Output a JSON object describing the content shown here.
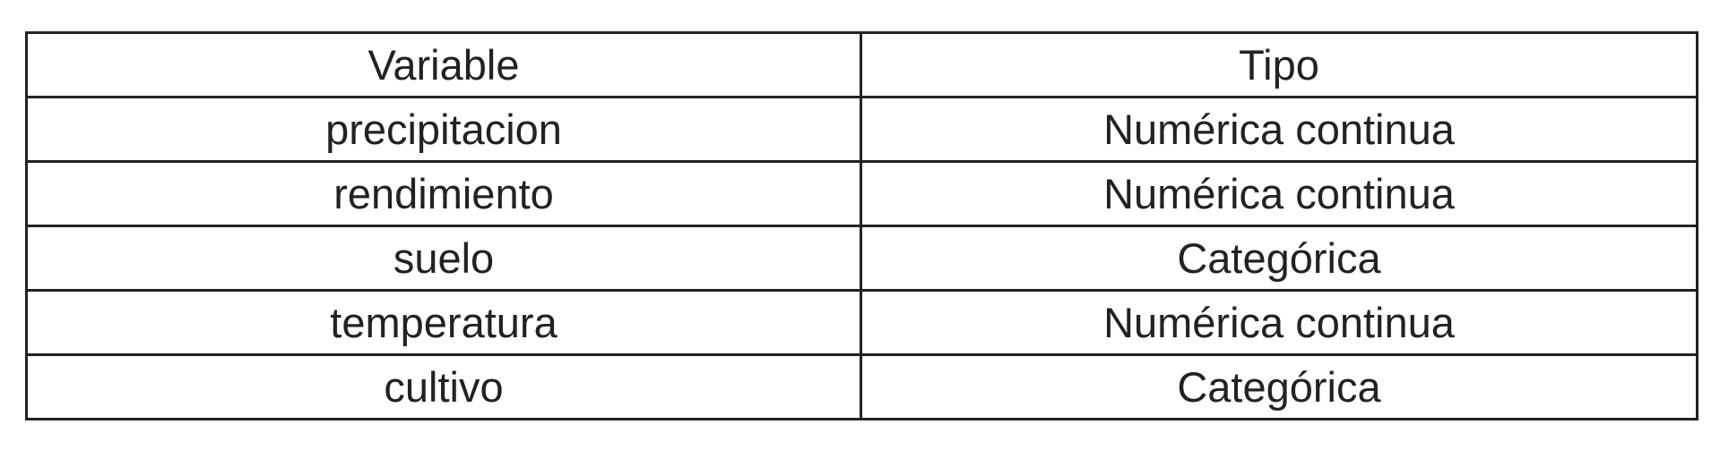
{
  "table": {
    "headers": [
      "Variable",
      "Tipo"
    ],
    "rows": [
      [
        "precipitacion",
        "Numérica continua"
      ],
      [
        "rendimiento",
        "Numérica continua"
      ],
      [
        "suelo",
        "Categórica"
      ],
      [
        "temperatura",
        "Numérica continua"
      ],
      [
        "cultivo",
        "Categórica"
      ]
    ]
  },
  "colors": {
    "text": "#222222",
    "border": "#222222",
    "background": "#ffffff"
  }
}
